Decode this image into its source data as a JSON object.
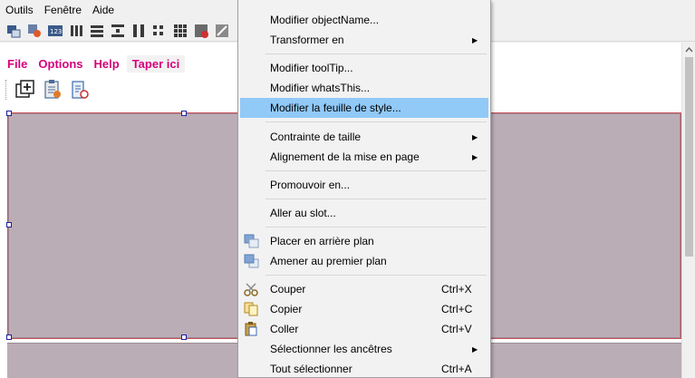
{
  "menubar": {
    "items": [
      {
        "label": "Outils"
      },
      {
        "label": "Fenêtre"
      },
      {
        "label": "Aide"
      }
    ]
  },
  "toolbar": {
    "icons": [
      "edit-widgets-icon",
      "edit-signals-icon",
      "edit-buddies-icon",
      "edit-tab-order-icon",
      "layout-horizontal-icon",
      "layout-vertical-icon",
      "layout-splitter-horizontal-icon",
      "layout-splitter-vertical-icon",
      "layout-form-icon",
      "layout-grid-icon",
      "break-layout-icon",
      "adjust-size-icon"
    ]
  },
  "form": {
    "menu_items": [
      {
        "label": "File"
      },
      {
        "label": "Options"
      },
      {
        "label": "Help"
      },
      {
        "label": "Taper ici"
      }
    ],
    "toolbar_icons": [
      "new-window-icon",
      "clipboard-icon",
      "clipboard-timer-icon"
    ],
    "central_color": "#bbadb6",
    "selection_color": "#c9525a",
    "accent_color": "#d6007b"
  },
  "context_menu": {
    "items": [
      {
        "label": "Modifier objectName..."
      },
      {
        "label": "Transformer en",
        "submenu": true
      },
      {
        "label": "Modifier toolTip..."
      },
      {
        "label": "Modifier whatsThis..."
      },
      {
        "label": "Modifier la feuille de style...",
        "highlighted": true
      },
      {
        "label": "Contrainte de taille",
        "submenu": true
      },
      {
        "label": "Alignement de la mise en page",
        "submenu": true
      },
      {
        "label": "Promouvoir en..."
      },
      {
        "label": "Aller au slot..."
      },
      {
        "label": "Placer en arrière plan",
        "icon": "send-to-back-icon"
      },
      {
        "label": "Amener au premier plan",
        "icon": "bring-to-front-icon"
      },
      {
        "label": "Couper",
        "shortcut": "Ctrl+X",
        "icon": "scissors-icon"
      },
      {
        "label": "Copier",
        "shortcut": "Ctrl+C",
        "icon": "copy-icon"
      },
      {
        "label": "Coller",
        "shortcut": "Ctrl+V",
        "icon": "paste-icon"
      },
      {
        "label": "Sélectionner les ancêtres",
        "submenu": true
      },
      {
        "label": "Tout sélectionner",
        "shortcut": "Ctrl+A"
      }
    ],
    "highlight_color": "#91c9f7"
  }
}
